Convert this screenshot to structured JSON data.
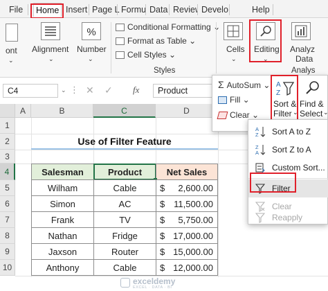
{
  "ribbon_tabs": [
    "File",
    "Home",
    "Insert",
    "Page L",
    "Formu",
    "Data",
    "Review",
    "Develo",
    "Help"
  ],
  "ribbon": {
    "font_label": "ont",
    "alignment_label": "Alignment",
    "number_label": "Number",
    "conditional_formatting": "Conditional Formatting",
    "format_as_table": "Format as Table",
    "cell_styles": "Cell Styles",
    "styles_group_label": "Styles",
    "cells_label": "Cells",
    "editing_label": "Editing",
    "analyze_label_1": "Analyz",
    "analyze_label_2": "Data",
    "analysis_group_label": "Analys"
  },
  "editing_panel": {
    "autosum": "AutoSum",
    "fill": "Fill",
    "clear": "Clear",
    "sort_filter_1": "Sort &",
    "sort_filter_2": "Filter",
    "find_select_1": "Find &",
    "find_select_2": "Select"
  },
  "sort_filter_menu": {
    "sort_az": "Sort A to Z",
    "sort_za": "Sort Z to A",
    "custom_sort": "Custom Sort...",
    "filter": "Filter",
    "clear": "Clear",
    "reapply": "Reapply"
  },
  "formula_bar": {
    "cell_ref": "C4",
    "fx": "fx",
    "content": "Product"
  },
  "sheet": {
    "columns": [
      "A",
      "B",
      "C",
      "D"
    ],
    "rows": [
      "1",
      "2",
      "3",
      "4",
      "5",
      "6",
      "7",
      "8",
      "9",
      "10"
    ],
    "title": "Use of Filter Feature",
    "headers": [
      "Salesman",
      "Product",
      "Net Sales"
    ],
    "data": [
      {
        "salesman": "Wilham",
        "product": "Cable",
        "currency": "$",
        "sales": "2,600.00"
      },
      {
        "salesman": "Simon",
        "product": "AC",
        "currency": "$",
        "sales": "11,500.00"
      },
      {
        "salesman": "Frank",
        "product": "TV",
        "currency": "$",
        "sales": "5,750.00"
      },
      {
        "salesman": "Nathan",
        "product": "Fridge",
        "currency": "$",
        "sales": "17,000.00"
      },
      {
        "salesman": "Jaxson",
        "product": "Router",
        "currency": "$",
        "sales": "15,000.00"
      },
      {
        "salesman": "Anthony",
        "product": "Cable",
        "currency": "$",
        "sales": "12,000.00"
      }
    ]
  },
  "watermark": {
    "name": "exceldemy",
    "tagline": "EXCEL · DATA · BI"
  },
  "colors": {
    "highlight_red": "#e0202a",
    "salesman_header_bg": "#e2efda",
    "product_header_bg": "#e2efda",
    "netsales_header_bg": "#fce4d6",
    "title_underline": "#9bc2e6",
    "excel_green": "#217346"
  }
}
